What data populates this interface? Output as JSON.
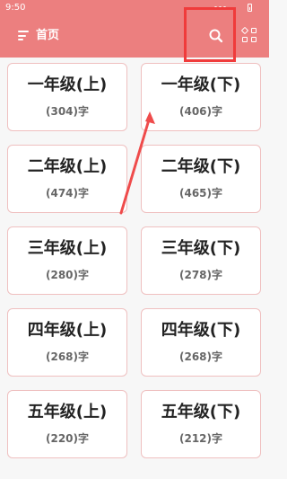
{
  "status_bar": {
    "time": "9:50"
  },
  "app_bar": {
    "title": "首页"
  },
  "cards": [
    {
      "title": "一年级(上)",
      "count": "(304)字"
    },
    {
      "title": "一年级(下)",
      "count": "(406)字"
    },
    {
      "title": "二年级(上)",
      "count": "(474)字"
    },
    {
      "title": "二年级(下)",
      "count": "(465)字"
    },
    {
      "title": "三年级(上)",
      "count": "(280)字"
    },
    {
      "title": "三年级(下)",
      "count": "(278)字"
    },
    {
      "title": "四年级(上)",
      "count": "(268)字"
    },
    {
      "title": "四年级(下)",
      "count": "(268)字"
    },
    {
      "title": "五年级(上)",
      "count": "(220)字"
    },
    {
      "title": "五年级(下)",
      "count": "(212)字"
    }
  ],
  "icons": {
    "menu": "menu-icon",
    "search": "search-icon",
    "grid": "grid-icon",
    "battery": "battery-icon"
  },
  "colors": {
    "header": "#ec7f7f",
    "highlight": "#f03b3b",
    "card_border": "#efc0c0"
  }
}
